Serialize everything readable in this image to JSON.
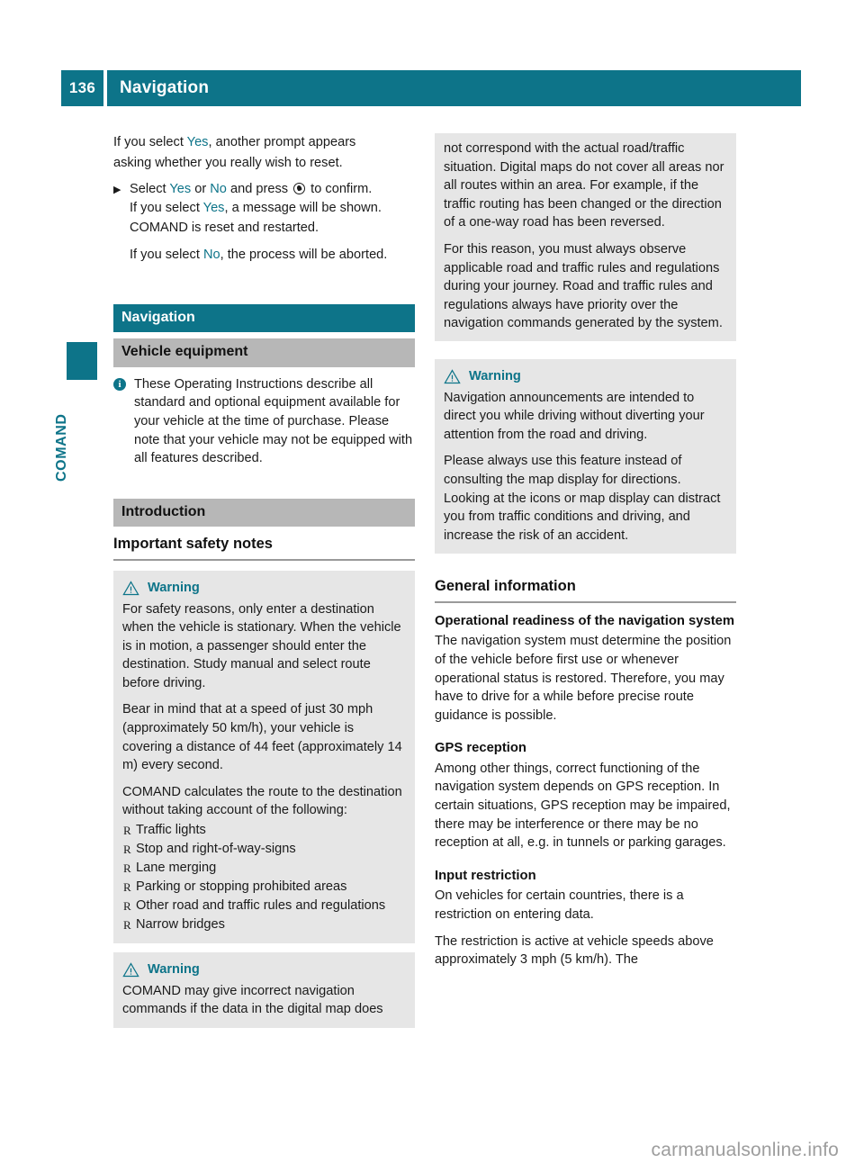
{
  "header": {
    "page_number": "136",
    "title": "Navigation"
  },
  "sidebar": {
    "chapter_label": "COMAND"
  },
  "icons": {
    "step_arrow": "▶",
    "bullet_mark": "R",
    "info_letter": "i",
    "knob_name": "controller-knob-icon"
  },
  "colors": {
    "accent_teal": "#0d7489",
    "bar_gray": "#b7b7b7",
    "box_gray": "#e6e6e6",
    "rule_gray": "#9a9a9a",
    "watermark_gray": "#9d9d9d"
  },
  "left_column": {
    "intro_para_1a": "If you select ",
    "intro_opt_yes": "Yes",
    "intro_para_1b": ", another prompt appears",
    "intro_para_1c": "asking whether you really wish to reset.",
    "step_1_a": "Select ",
    "step_1_yes": "Yes",
    "step_1_b": " or ",
    "step_1_no": "No",
    "step_1_c": " and press ",
    "step_1_d": " to confirm.",
    "step_sub_1a": "If you select ",
    "step_sub_1_yes": "Yes",
    "step_sub_1b": ", a message will be shown.",
    "step_sub_1c": "COMAND is reset and restarted.",
    "step_sub_2a": "If you select ",
    "step_sub_2_no": "No",
    "step_sub_2b": ", the process will be aborted.",
    "section_navigation": "Navigation",
    "section_vehicle_equipment": "Vehicle equipment",
    "vehicle_equipment_note": "These Operating Instructions describe all standard and optional equipment available for your vehicle at the time of purchase. Please note that your vehicle may not be equipped with all features described.",
    "section_introduction": "Introduction",
    "heading_important_safety_notes": "Important safety notes",
    "warning_label": "Warning",
    "warning_1_p1": "For safety reasons, only enter a destination when the vehicle is stationary. When the vehicle is in motion, a passenger should enter the destination. Study manual and select route before driving.",
    "warning_1_p2": "Bear in mind that at a speed of just 30 mph (approximately 50 km/h), your vehicle is covering a distance of 44 feet (approximately 14 m) every second.",
    "warning_1_p3": "COMAND calculates the route to the destination without taking account of the following:",
    "warning_1_list": [
      "Traffic lights",
      "Stop and right-of-way-signs",
      "Lane merging",
      "Parking or stopping prohibited areas",
      "Other road and traffic rules and regulations",
      "Narrow bridges"
    ],
    "warning_2_label": "Warning",
    "warning_2_p1": "COMAND may give incorrect navigation commands if the data in the digital map does"
  },
  "right_column": {
    "warning_2_cont_p1": "not correspond with the actual road/traffic situation. Digital maps do not cover all areas nor all routes within an area. For example, if the traffic routing has been changed or the direction of a one-way road has been reversed.",
    "warning_2_cont_p2": "For this reason, you must always observe applicable road and traffic rules and regulations during your journey. Road and traffic rules and regulations always have priority over the navigation commands generated by the system.",
    "warning_3_label": "Warning",
    "warning_3_p1": "Navigation announcements are intended to direct you while driving without diverting your attention from the road and driving.",
    "warning_3_p2": "Please always use this feature instead of consulting the map display for directions. Looking at the icons or map display can distract you from traffic conditions and driving, and increase the risk of an accident.",
    "heading_general_information": "General information",
    "sub_operational_readiness": "Operational readiness of the navigation system",
    "operational_readiness_body": "The navigation system must determine the position of the vehicle before first use or whenever operational status is restored. Therefore, you may have to drive for a while before precise route guidance is possible.",
    "sub_gps_reception": "GPS reception",
    "gps_reception_body": "Among other things, correct functioning of the navigation system depends on GPS reception. In certain situations, GPS reception may be impaired, there may be interference or there may be no reception at all, e.g. in tunnels or parking garages.",
    "sub_input_restriction": "Input restriction",
    "input_restriction_p1": "On vehicles for certain countries, there is a restriction on entering data.",
    "input_restriction_p2": "The restriction is active at vehicle speeds above approximately 3 mph (5 km/h). The"
  },
  "footer": {
    "watermark": "carmanualsonline.info"
  }
}
